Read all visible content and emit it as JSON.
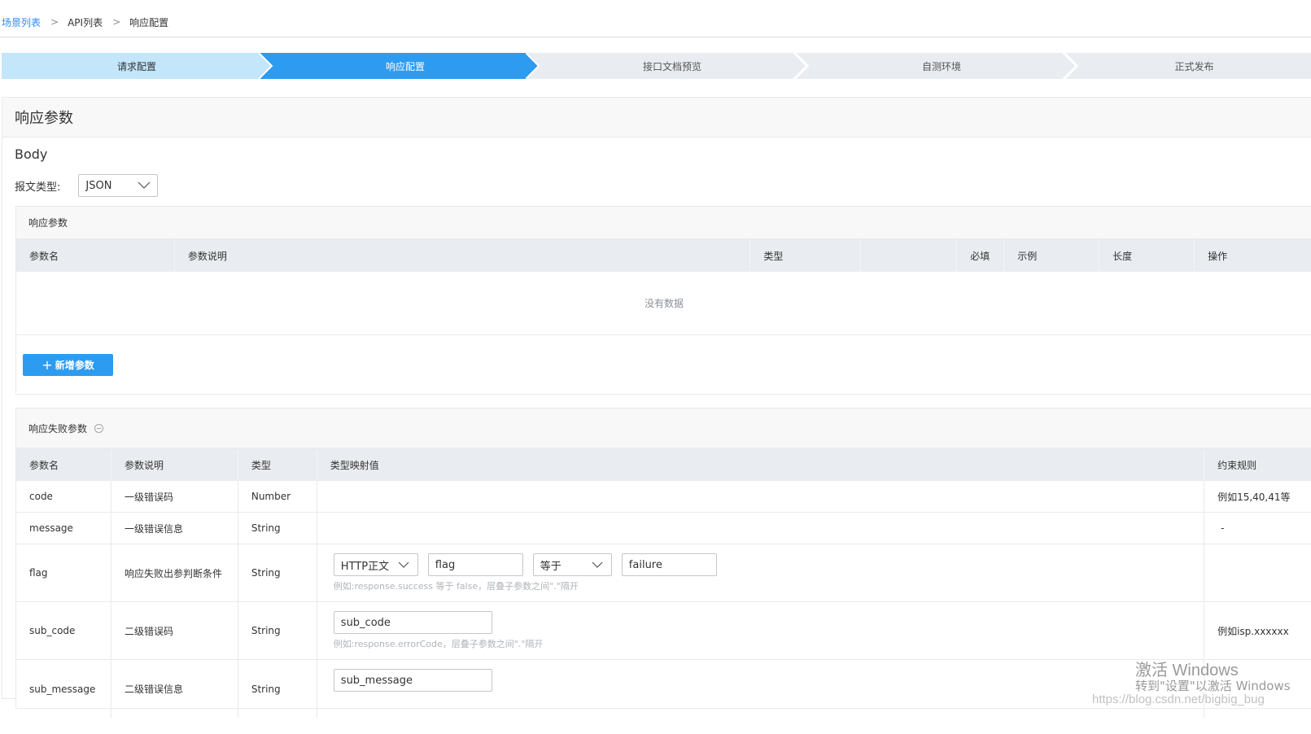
{
  "breadcrumb": {
    "items": [
      "场景列表",
      "API列表",
      "响应配置"
    ],
    "separator": ">"
  },
  "steps": [
    {
      "label": "请求配置",
      "state": "done"
    },
    {
      "label": "响应配置",
      "state": "active"
    },
    {
      "label": "接口文档预览",
      "state": "pending"
    },
    {
      "label": "自测环境",
      "state": "pending"
    },
    {
      "label": "正式发布",
      "state": "pending"
    }
  ],
  "panel": {
    "title": "响应参数",
    "body_title": "Body",
    "msg_type_label": "报文类型:",
    "msg_type_value": "JSON"
  },
  "response_params": {
    "title": "响应参数",
    "columns": [
      "参数名",
      "参数说明",
      "类型",
      "",
      "必填",
      "示例",
      "长度",
      "操作"
    ],
    "empty_text": "没有数据",
    "add_button": "新增参数"
  },
  "failure_params": {
    "title": "响应失败参数",
    "columns": [
      "参数名",
      "参数说明",
      "类型",
      "类型映射值",
      "约束规则"
    ],
    "rows": [
      {
        "name": "code",
        "desc": "一级错误码",
        "type": "Number",
        "rule": "例如15,40,41等"
      },
      {
        "name": "message",
        "desc": "一级错误信息",
        "type": "String",
        "rule": "-"
      },
      {
        "name": "flag",
        "desc": "响应失败出参判断条件",
        "type": "String",
        "rule": "",
        "mapping": {
          "source": "HTTP正文",
          "field": "flag",
          "operator": "等于",
          "value": "failure",
          "hint": "例如:response.success 等于 false，层叠子参数之间\".\"隔开"
        }
      },
      {
        "name": "sub_code",
        "desc": "二级错误码",
        "type": "String",
        "rule": "例如isp.xxxxxx",
        "mapping": {
          "field": "sub_code",
          "hint": "例如:response.errorCode，层叠子参数之间\".\"隔开"
        }
      },
      {
        "name": "sub_message",
        "desc": "二级错误信息",
        "type": "String",
        "rule": "",
        "mapping": {
          "field": "sub_message"
        }
      }
    ]
  },
  "watermark": {
    "line1": "激活 Windows",
    "line2": "转到\"设置\"以激活 Windows",
    "url": "https://blog.csdn.net/bigbig_bug"
  },
  "colors": {
    "accent": "#2d9bf0",
    "step_done": "#c3e6fb",
    "step_active": "#2d9bf0",
    "step_pending": "#e9ecf0"
  }
}
